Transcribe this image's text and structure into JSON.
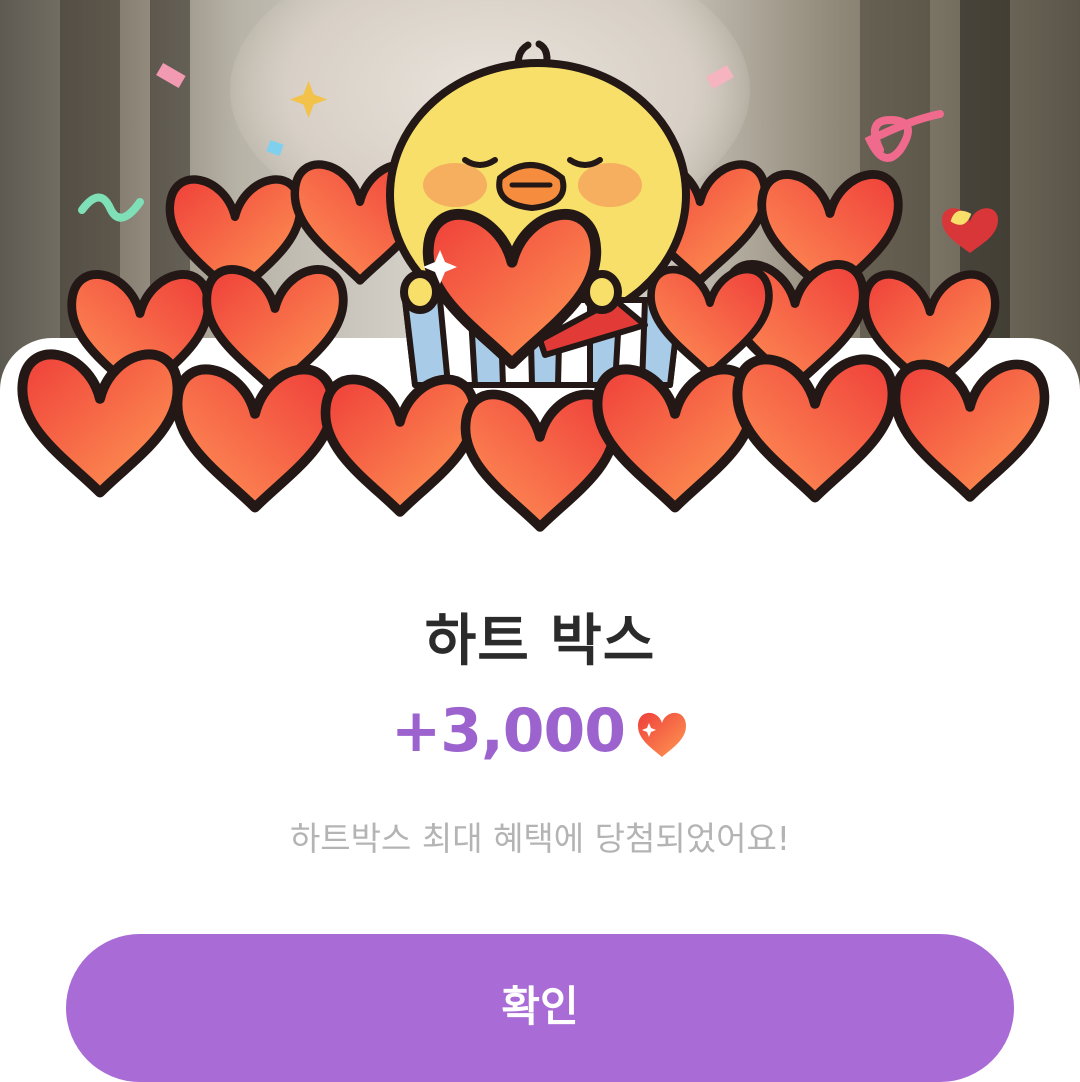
{
  "reward_popup": {
    "title": "하트 박스",
    "amount": "+3,000",
    "description": "하트박스 최대 혜택에 당첨되었어요!",
    "confirm_label": "확인",
    "amount_icon": "heart-icon",
    "illustration": "chick-with-heart-pile"
  },
  "colors": {
    "accent_purple": "#a96bd6",
    "amount_purple": "#9c63cf",
    "heart_red": "#f24a3c",
    "heart_orange": "#ff8a50",
    "chick_yellow": "#f7df6a"
  }
}
